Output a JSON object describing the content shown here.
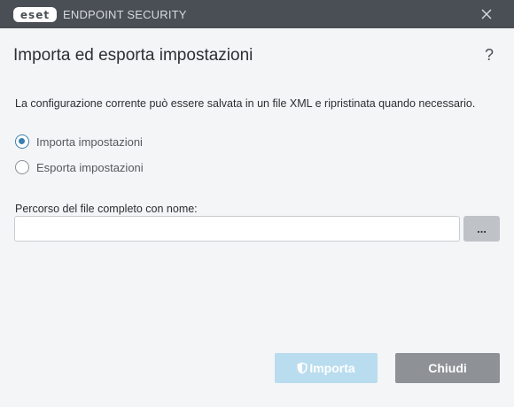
{
  "titlebar": {
    "logo_text": "eset",
    "product_name": "ENDPOINT SECURITY",
    "close_icon": "close-icon"
  },
  "dialog": {
    "title": "Importa ed esporta impostazioni",
    "help_label": "?",
    "description": "La configurazione corrente può essere salvata in un file XML e ripristinata quando necessario."
  },
  "options": [
    {
      "label": "Importa impostazioni",
      "checked": true
    },
    {
      "label": "Esporta impostazioni",
      "checked": false
    }
  ],
  "path": {
    "label": "Percorso del file completo con nome:",
    "value": "",
    "browse_label": "..."
  },
  "buttons": {
    "import_label": "Importa",
    "import_icon": "shield-icon",
    "close_label": "Chiudi"
  },
  "colors": {
    "titlebar": "#4a4f55",
    "accent": "#3b7fb0",
    "import_disabled": "#b9dcef",
    "close_button": "#8e9297"
  }
}
